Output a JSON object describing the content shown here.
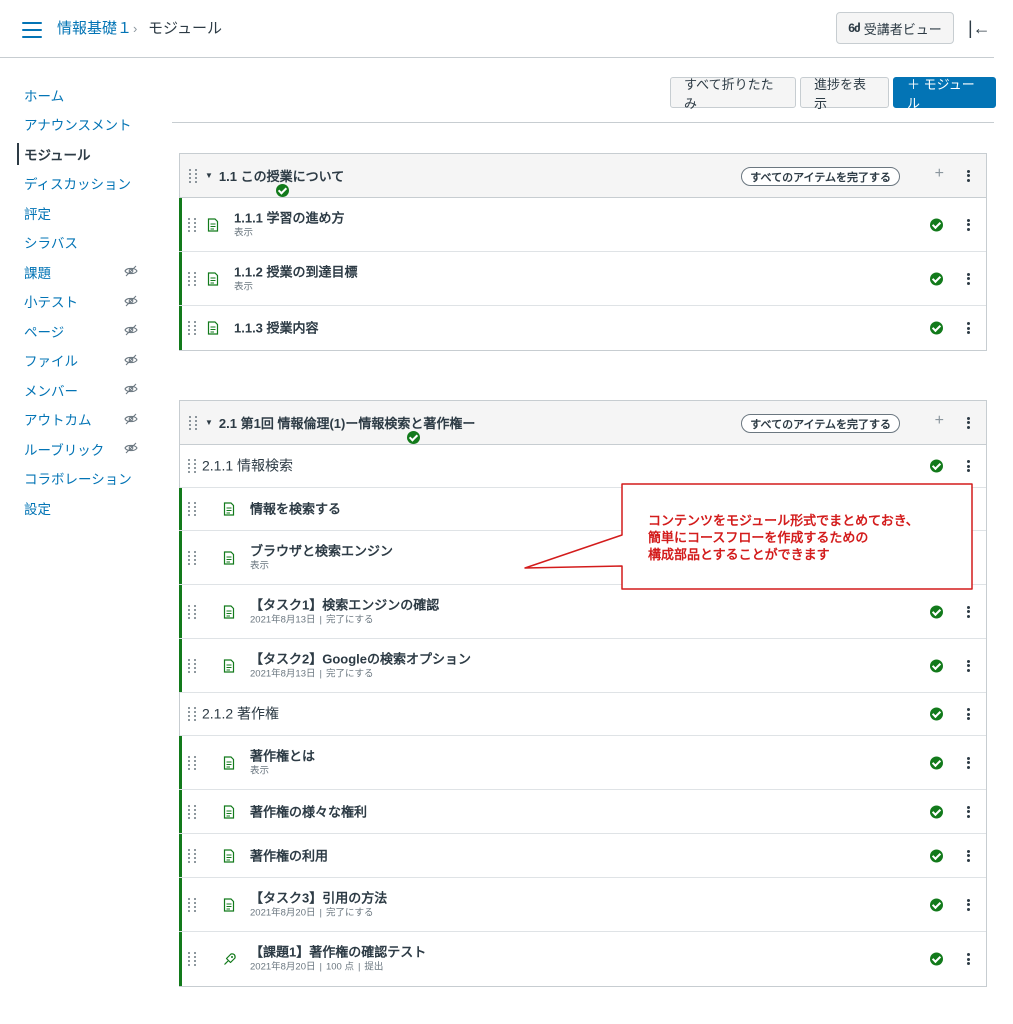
{
  "header": {
    "course": "情報基礎１",
    "separator": "›",
    "current": "モジュール",
    "student_view_icon": "6ძ",
    "student_view_label": "受講者ビュー",
    "collapse_icon": "|←"
  },
  "sidebar": {
    "items": [
      {
        "label": "ホーム",
        "hidden": false,
        "active": false
      },
      {
        "label": "アナウンスメント",
        "hidden": false,
        "active": false
      },
      {
        "label": "モジュール",
        "hidden": false,
        "active": true
      },
      {
        "label": "ディスカッション",
        "hidden": false,
        "active": false
      },
      {
        "label": "評定",
        "hidden": false,
        "active": false
      },
      {
        "label": "シラバス",
        "hidden": false,
        "active": false
      },
      {
        "label": "課題",
        "hidden": true,
        "active": false
      },
      {
        "label": "小テスト",
        "hidden": true,
        "active": false
      },
      {
        "label": "ページ",
        "hidden": true,
        "active": false
      },
      {
        "label": "ファイル",
        "hidden": true,
        "active": false
      },
      {
        "label": "メンバー",
        "hidden": true,
        "active": false
      },
      {
        "label": "アウトカム",
        "hidden": true,
        "active": false
      },
      {
        "label": "ルーブリック",
        "hidden": true,
        "active": false
      },
      {
        "label": "コラボレーション",
        "hidden": false,
        "active": false
      },
      {
        "label": "設定",
        "hidden": false,
        "active": false
      }
    ]
  },
  "toolbar": {
    "collapse_all": "すべて折りたたみ",
    "view_progress": "進捗を表示",
    "add_module": "＋ モジュール"
  },
  "modules": [
    {
      "title": "1.1 この授業について",
      "requirement": "すべてのアイテムを完了する",
      "plus": "+",
      "items": [
        {
          "title": "1.1.1 学習の進め方",
          "sub": [
            "表示"
          ]
        },
        {
          "title": "1.1.2 授業の到達目標",
          "sub": [
            "表示"
          ]
        },
        {
          "title": "1.1.3 授業内容",
          "sub": []
        }
      ]
    },
    {
      "title": "2.1 第1回 情報倫理(1)ー情報検索と著作権ー",
      "requirement": "すべてのアイテムを完了する",
      "plus": "+",
      "items": [
        {
          "title": "2.1.1 情報検索",
          "sub": []
        },
        {
          "title": "情報を検索する",
          "sub": []
        },
        {
          "title": "ブラウザと検索エンジン",
          "sub": [
            "表示"
          ]
        },
        {
          "title": "【タスク1】検索エンジンの確認",
          "sub": [
            "2021年8月13日",
            "完了にする"
          ]
        },
        {
          "title": "【タスク2】Googleの検索オプション",
          "sub": [
            "2021年8月13日",
            "完了にする"
          ]
        },
        {
          "title": "2.1.2 著作権",
          "sub": []
        },
        {
          "title": "著作権とは",
          "sub": [
            "表示"
          ]
        },
        {
          "title": "著作権の様々な権利",
          "sub": []
        },
        {
          "title": "著作権の利用",
          "sub": []
        },
        {
          "title": "【タスク3】引用の方法",
          "sub": [
            "2021年8月20日",
            "完了にする"
          ]
        },
        {
          "title": "【課題1】著作権の確認テスト",
          "sub": [
            "2021年8月20日",
            "100 点",
            "提出"
          ]
        }
      ]
    }
  ],
  "callout": {
    "lines": [
      "コンテンツをモジュール形式でまとめておき、",
      "簡単にコースフローを作成するための",
      "構成部品とすることができます"
    ],
    "color": "#d31c1c"
  },
  "colors": {
    "link": "#0374b5",
    "complete": "#127a1b",
    "text": "#2d3b45"
  }
}
